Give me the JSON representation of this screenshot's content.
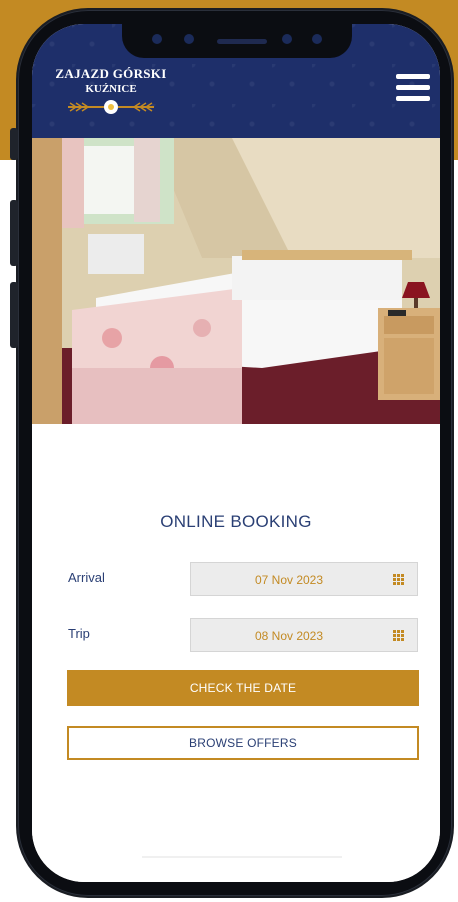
{
  "brand": {
    "line1": "ZAJAZD GÓRSKI",
    "line2": "KUŹNICE"
  },
  "header": {
    "menu_icon": "hamburger-menu-icon"
  },
  "booking": {
    "title": "ONLINE BOOKING",
    "arrival_label": "Arrival",
    "arrival_value": "07 Nov 2023",
    "trip_label": "Trip",
    "trip_value": "08 Nov 2023",
    "calendar_icon": "calendar-icon",
    "check_button": "CHECK THE DATE",
    "browse_button": "BROWSE OFFERS"
  },
  "colors": {
    "gold": "#c38a23",
    "navy": "#1e2f6a",
    "text_navy": "#2a3f74"
  }
}
